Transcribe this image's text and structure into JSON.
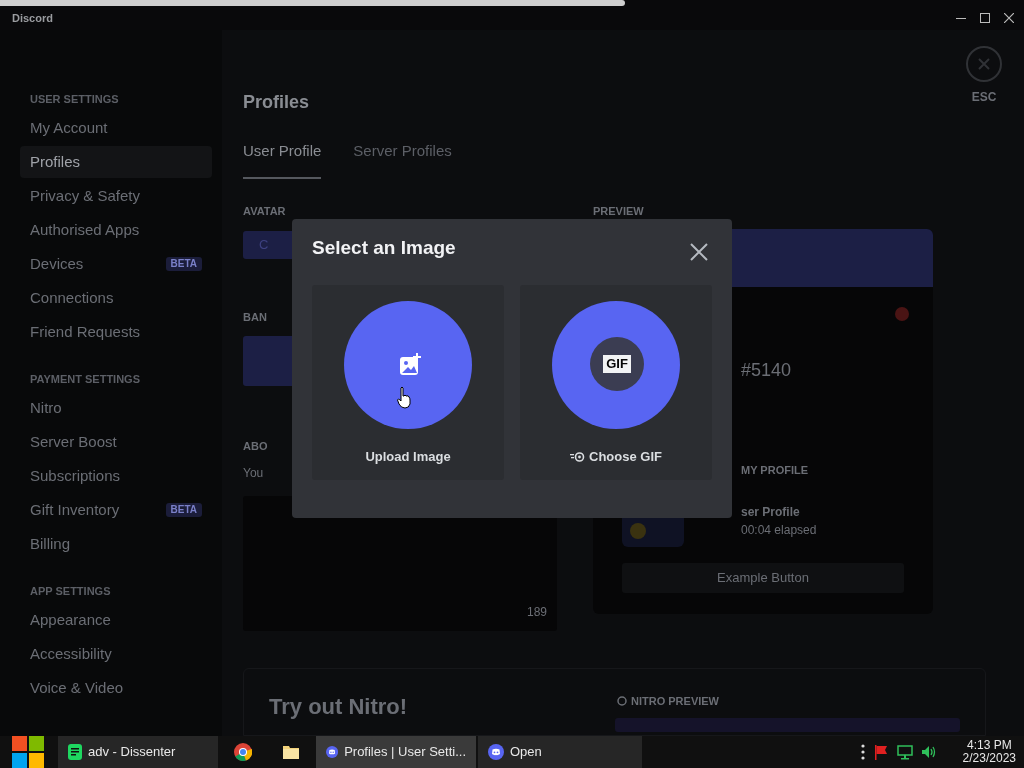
{
  "window": {
    "title": "Discord"
  },
  "sidebar": {
    "sections": [
      {
        "header": "USER SETTINGS",
        "items": [
          {
            "label": "My Account",
            "selected": false
          },
          {
            "label": "Profiles",
            "selected": true
          },
          {
            "label": "Privacy & Safety",
            "selected": false
          },
          {
            "label": "Authorised Apps",
            "selected": false
          },
          {
            "label": "Devices",
            "selected": false,
            "badge": "BETA"
          },
          {
            "label": "Connections",
            "selected": false
          },
          {
            "label": "Friend Requests",
            "selected": false
          }
        ]
      },
      {
        "header": "PAYMENT SETTINGS",
        "items": [
          {
            "label": "Nitro",
            "selected": false
          },
          {
            "label": "Server Boost",
            "selected": false
          },
          {
            "label": "Subscriptions",
            "selected": false
          },
          {
            "label": "Gift Inventory",
            "selected": false,
            "badge": "BETA"
          },
          {
            "label": "Billing",
            "selected": false
          }
        ]
      },
      {
        "header": "APP SETTINGS",
        "items": [
          {
            "label": "Appearance",
            "selected": false
          },
          {
            "label": "Accessibility",
            "selected": false
          },
          {
            "label": "Voice & Video",
            "selected": false
          }
        ]
      }
    ]
  },
  "page": {
    "title": "Profiles",
    "tabs": [
      {
        "label": "User Profile",
        "selected": true
      },
      {
        "label": "Server Profiles",
        "selected": false
      }
    ],
    "close_label": "ESC",
    "avatar_label": "AVATAR",
    "avatar_button": "C",
    "banner_label": "BAN",
    "about_label": "ABO",
    "about_hint": "You",
    "about_count": "189",
    "preview_label": "PREVIEW",
    "preview_tag": "#5140",
    "preview_section": "MY PROFILE",
    "activity_title": "ser Profile",
    "activity_time": "00:04 elapsed",
    "example_button": "Example Button",
    "nitro_title": "Try out Nitro!",
    "nitro_preview": "NITRO PREVIEW"
  },
  "dialog": {
    "title": "Select an Image",
    "options": [
      {
        "kind": "upload",
        "label": "Upload Image"
      },
      {
        "kind": "gif",
        "label": "Choose GIF",
        "badge": "GIF"
      }
    ]
  },
  "taskbar": {
    "items": [
      {
        "kind": "note",
        "label": "adv - Dissenter",
        "selected": false
      },
      {
        "kind": "chrome",
        "selected": false
      },
      {
        "kind": "folder",
        "selected": false
      },
      {
        "kind": "discord",
        "label": "Profiles | User Setti...",
        "selected": true
      },
      {
        "kind": "discord",
        "label": "Open",
        "selected": false
      }
    ],
    "time": "4:13 PM",
    "date": "2/23/2023"
  }
}
